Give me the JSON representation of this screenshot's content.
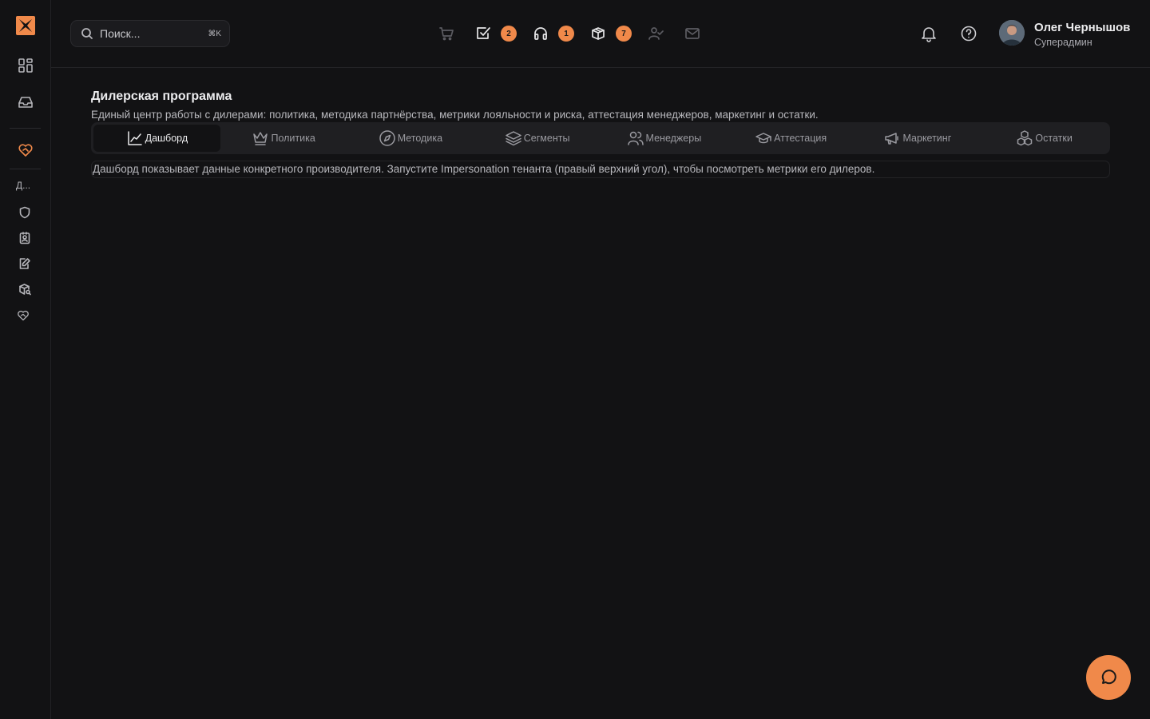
{
  "colors": {
    "accent": "#f0894a",
    "background": "#121214",
    "panel": "#1f1f22"
  },
  "sidebar": {
    "logo_icon": "brand-logo-icon",
    "items": [
      {
        "name": "dashboard",
        "icon": "grid-icon"
      },
      {
        "name": "inbox",
        "icon": "inbox-icon"
      },
      {
        "name": "dealer-program",
        "icon": "handshake-heart-icon"
      }
    ],
    "section_label": "Д...",
    "sub_items": [
      {
        "name": "policy",
        "icon": "shield-icon"
      },
      {
        "name": "managers",
        "icon": "contact-badge-icon"
      },
      {
        "name": "attestation",
        "icon": "edit-doc-icon"
      },
      {
        "name": "stock",
        "icon": "package-search-icon"
      },
      {
        "name": "dealer-program",
        "icon": "handshake-heart-icon"
      }
    ]
  },
  "header": {
    "search": {
      "placeholder": "Поиск...",
      "shortcut": "⌘K"
    },
    "quick": [
      {
        "name": "cart",
        "icon": "cart-icon",
        "badge": null
      },
      {
        "name": "tasks",
        "icon": "checkbox-icon",
        "badge": "2"
      },
      {
        "name": "support",
        "icon": "headphones-icon",
        "badge": "1"
      },
      {
        "name": "packages",
        "icon": "package-icon",
        "badge": "7"
      },
      {
        "name": "user-check",
        "icon": "user-check-icon",
        "badge": null
      },
      {
        "name": "mail",
        "icon": "mail-icon",
        "badge": null
      }
    ],
    "user": {
      "name": "Олег Чернышов",
      "role": "Суперадмин"
    }
  },
  "main": {
    "title": "Дилерская программа",
    "subtitle": "Единый центр работы с дилерами: политика, методика партнёрства, метрики лояльности и риска, аттестация менеджеров, маркетинг и остатки.",
    "tabs": [
      {
        "label": "Дашборд",
        "icon": "line-chart-icon",
        "active": true
      },
      {
        "label": "Политика",
        "icon": "crown-icon",
        "active": false
      },
      {
        "label": "Методика",
        "icon": "compass-icon",
        "active": false
      },
      {
        "label": "Сегменты",
        "icon": "layers-icon",
        "active": false
      },
      {
        "label": "Менеджеры",
        "icon": "users-icon",
        "active": false
      },
      {
        "label": "Аттестация",
        "icon": "graduation-cap-icon",
        "active": false
      },
      {
        "label": "Маркетинг",
        "icon": "megaphone-icon",
        "active": false
      },
      {
        "label": "Остатки",
        "icon": "boxes-icon",
        "active": false
      }
    ],
    "info": "Дашборд показывает данные конкретного производителя. Запустите Impersonation тенанта (правый верхний угол), чтобы посмотреть метрики его дилеров."
  }
}
